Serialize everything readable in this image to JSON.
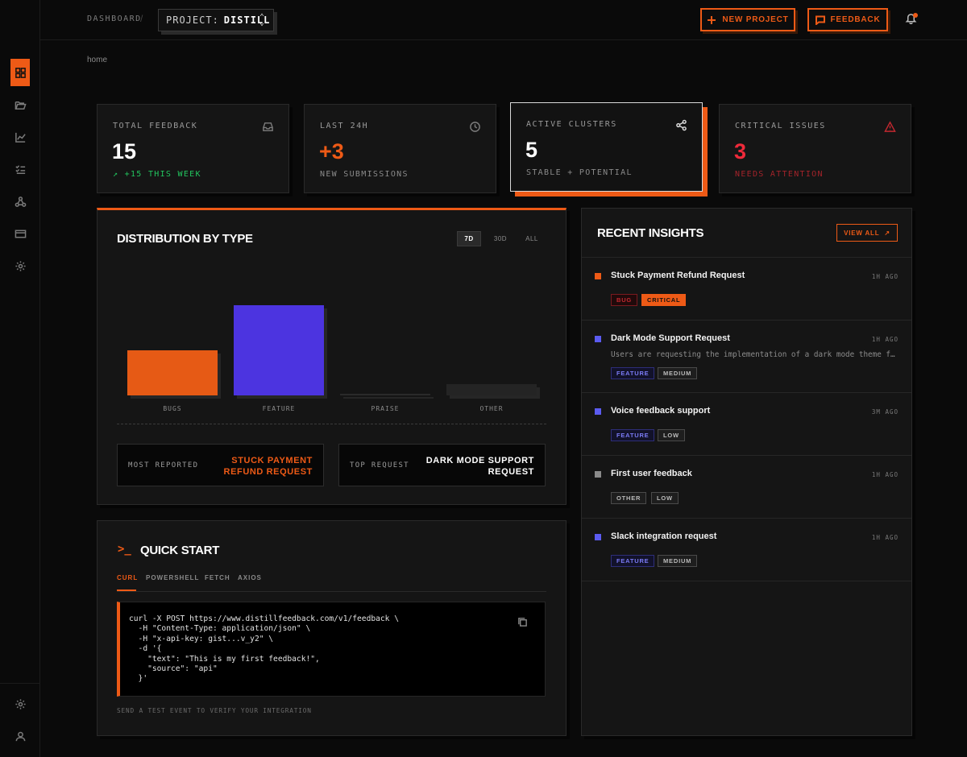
{
  "colors": {
    "accent": "#ee5a16",
    "feature": "#4f46e5",
    "critical_red": "#ef2a3a",
    "success_green": "#22c55e"
  },
  "topbar": {
    "breadcrumb": "DASHBOARD",
    "separator": "/",
    "project_label": "PROJECT:",
    "project_name": "DISTILL",
    "new_project_label": "NEW PROJECT",
    "feedback_label": "FEEDBACK"
  },
  "sidebar": {
    "items": [
      {
        "icon": "grid-icon",
        "active": true
      },
      {
        "icon": "folder-icon"
      },
      {
        "icon": "line-chart-icon"
      },
      {
        "icon": "checklist-icon"
      },
      {
        "icon": "webhook-icon"
      },
      {
        "icon": "credit-card-icon"
      },
      {
        "icon": "settings-icon"
      }
    ],
    "bottom": [
      {
        "icon": "settings-icon"
      },
      {
        "icon": "user-icon"
      }
    ]
  },
  "page": {
    "crumb": "home"
  },
  "stats": [
    {
      "label": "TOTAL FEEDBACK",
      "value": "15",
      "sub": "+15 THIS WEEK",
      "icon": "inbox-icon"
    },
    {
      "label": "LAST 24H",
      "value": "+3",
      "sub": "NEW SUBMISSIONS",
      "icon": "clock-icon"
    },
    {
      "label": "ACTIVE CLUSTERS",
      "value": "5",
      "sub": "STABLE + POTENTIAL",
      "icon": "share-icon"
    },
    {
      "label": "CRITICAL ISSUES",
      "value": "3",
      "sub": "NEEDS ATTENTION",
      "icon": "alert-triangle-icon"
    }
  ],
  "distribution": {
    "title": "DISTRIBUTION BY TYPE",
    "ranges": [
      "7D",
      "30D",
      "ALL"
    ],
    "selected_range": "7D",
    "most_reported_label": "MOST REPORTED",
    "most_reported_value": "STUCK PAYMENT REFUND REQUEST",
    "top_request_label": "TOP REQUEST",
    "top_request_value": "DARK MODE SUPPORT REQUEST"
  },
  "chart_data": {
    "type": "bar",
    "categories": [
      "BUGS",
      "FEATURE",
      "PRAISE",
      "OTHER"
    ],
    "values": [
      1,
      2,
      0,
      0.25
    ],
    "colors": [
      "#e65a15",
      "#4c34e0",
      "#2a2a2a",
      "#242424"
    ],
    "ylim": [
      0,
      2
    ],
    "grid": false
  },
  "quickstart": {
    "title": "QUICK START",
    "prompt_symbol": ">_",
    "tabs": [
      "CURL",
      "POWERSHELL",
      "FETCH",
      "AXIOS"
    ],
    "active_tab": "CURL",
    "code": "curl -X POST https://www.distillfeedback.com/v1/feedback \\\n  -H \"Content-Type: application/json\" \\\n  -H \"x-api-key: gist...v_y2\" \\\n  -d '{\n    \"text\": \"This is my first feedback!\",\n    \"source\": \"api\"\n  }'",
    "hint": "SEND A TEST EVENT TO VERIFY YOUR INTEGRATION"
  },
  "insights": {
    "title": "RECENT INSIGHTS",
    "view_all_label": "VIEW ALL",
    "items": [
      {
        "title": "Stuck Payment Refund Request",
        "time": "1H AGO",
        "description": "",
        "color": "#ee5a16",
        "tags": [
          "BUG",
          "CRITICAL"
        ]
      },
      {
        "title": "Dark Mode Support Request",
        "time": "1H AGO",
        "description": "Users are requesting the implementation of a dark mode theme for the application interface",
        "color": "#5b5bf0",
        "tags": [
          "FEATURE",
          "MEDIUM"
        ]
      },
      {
        "title": "Voice feedback support",
        "time": "3M AGO",
        "description": "",
        "color": "#5b5bf0",
        "tags": [
          "FEATURE",
          "LOW"
        ]
      },
      {
        "title": "First user feedback",
        "time": "1H AGO",
        "description": "",
        "color": "#8a8a8a",
        "tags": [
          "OTHER",
          "LOW"
        ]
      },
      {
        "title": "Slack integration request",
        "time": "1H AGO",
        "description": "",
        "color": "#5b5bf0",
        "tags": [
          "FEATURE",
          "MEDIUM"
        ]
      }
    ]
  }
}
